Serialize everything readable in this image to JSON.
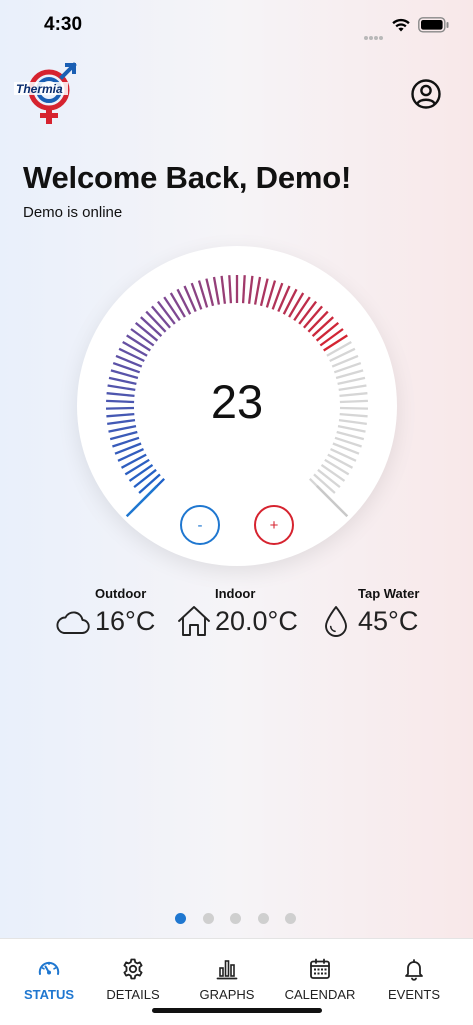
{
  "status_bar": {
    "time": "4:30"
  },
  "brand": {
    "logo_text": "Thermia"
  },
  "welcome": {
    "title": "Welcome Back, Demo!",
    "status": "Demo is online"
  },
  "dial": {
    "setpoint": "23",
    "minus_label": "-",
    "plus_label": "+",
    "level_fraction": 0.72
  },
  "readouts": [
    {
      "label": "Outdoor",
      "value": "16°C",
      "icon": "cloud-icon"
    },
    {
      "label": "Indoor",
      "value": "20.0°C",
      "icon": "house-icon"
    },
    {
      "label": "Tap Water",
      "value": "45°C",
      "icon": "water-drop-icon"
    }
  ],
  "pager": {
    "count": 5,
    "active": 0
  },
  "tabs": [
    {
      "label": "STATUS",
      "icon": "gauge-icon",
      "active": true
    },
    {
      "label": "DETAILS",
      "icon": "gear-icon",
      "active": false
    },
    {
      "label": "GRAPHS",
      "icon": "bar-chart-icon",
      "active": false
    },
    {
      "label": "CALENDAR",
      "icon": "calendar-icon",
      "active": false
    },
    {
      "label": "EVENTS",
      "icon": "bell-icon",
      "active": false
    }
  ],
  "colors": {
    "accent_blue": "#1f77d0",
    "accent_red": "#d6232f",
    "inactive_tick": "#d6d6d6"
  }
}
